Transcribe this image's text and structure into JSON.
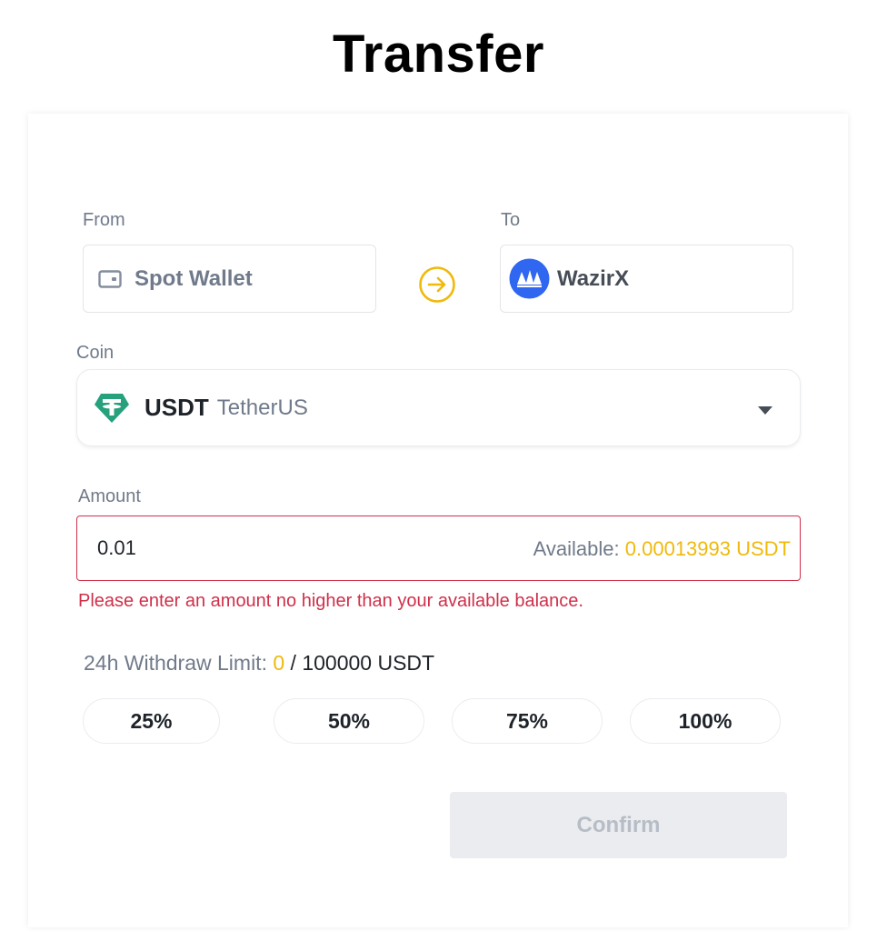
{
  "page": {
    "title": "Transfer"
  },
  "from": {
    "label": "From",
    "wallet": "Spot Wallet",
    "icon": "wallet-icon"
  },
  "to": {
    "label": "To",
    "wallet": "WazirX",
    "icon": "wazirx-logo-icon"
  },
  "swap": {
    "icon": "arrow-right-circle-icon",
    "color": "#f0b90b"
  },
  "coin": {
    "label": "Coin",
    "symbol": "USDT",
    "name": "TetherUS",
    "icon": "tether-icon",
    "icon_color": "#26a17b"
  },
  "amount": {
    "label": "Amount",
    "value": "0.01",
    "available_label": "Available:",
    "available_value": "0.00013993 USDT",
    "error": "Please enter an amount no higher than your available balance."
  },
  "limit": {
    "label": "24h Withdraw Limit:",
    "used": "0",
    "separator": "/",
    "max": "100000 USDT"
  },
  "percent_buttons": [
    "25%",
    "50%",
    "75%",
    "100%"
  ],
  "confirm": {
    "label": "Confirm"
  },
  "colors": {
    "accent": "#f0b90b",
    "error": "#cf304a",
    "muted": "#707a8a",
    "disabled_bg": "#eaecef"
  }
}
